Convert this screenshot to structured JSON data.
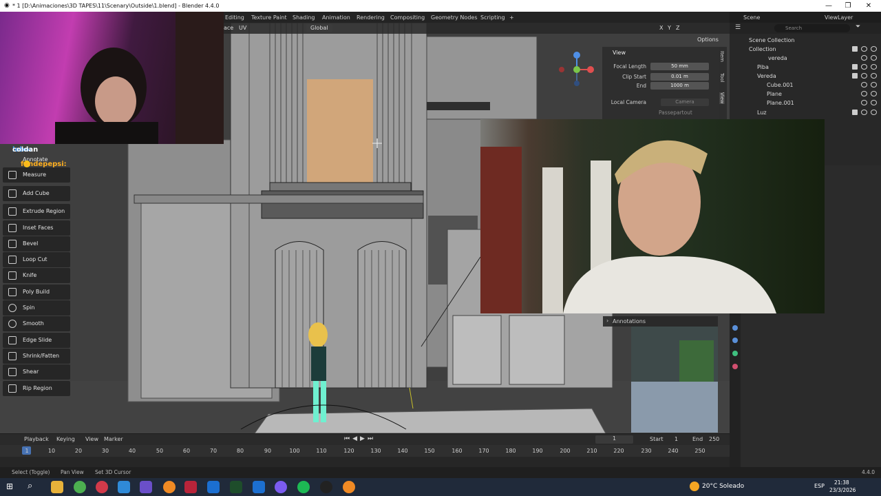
{
  "title_bar": {
    "title": "* 1 [D:\\Animaciones\\3D TAPES\\11\\Scenary\\Outside\\1.blend] - Blender 4.4.0",
    "min": "—",
    "max": "❐",
    "close": "✕"
  },
  "workspace_tabs": [
    "Editing",
    "Texture Paint",
    "Shading",
    "Animation",
    "Rendering",
    "Compositing",
    "Geometry Nodes",
    "Scripting",
    "+"
  ],
  "scene": {
    "label": "Scene",
    "view_layer": "ViewLayer"
  },
  "viewport_header": {
    "face_label": "ace",
    "uv": "UV",
    "orientation": "Global",
    "options": "Options",
    "axes": [
      "X",
      "Y",
      "Z"
    ]
  },
  "tools": [
    "Annotate",
    "Measure",
    "Add Cube",
    "Extrude Region",
    "Inset Faces",
    "Bevel",
    "Loop Cut",
    "Knife",
    "Poly Build",
    "Spin",
    "Smooth",
    "Edge Slide",
    "Shrink/Fatten",
    "Shear",
    "Rip Region"
  ],
  "chat": [
    {
      "user": "lobo:",
      "msg": "coldan",
      "color": "#4aa3ff"
    },
    {
      "user": "fandepepsi:",
      "msg": "",
      "color": "#ffb020"
    }
  ],
  "view_panel": {
    "header": "View",
    "focal_length_label": "Focal Length",
    "focal_length": "50 mm",
    "clip_start_label": "Clip Start",
    "clip_start": "0.01 m",
    "end_label": "End",
    "clip_end": "1000 m",
    "local_camera_label": "Local Camera",
    "camera": "Camera",
    "passepartout": "Passepartout",
    "tabs": [
      "Item",
      "Tool",
      "View"
    ]
  },
  "annotations_label": "Annotations",
  "outliner": {
    "search_placeholder": "Search",
    "root": "Scene Collection",
    "rows": [
      {
        "name": "Collection",
        "indent": 0
      },
      {
        "name": "vereda",
        "indent": 1
      },
      {
        "name": "Piba",
        "indent": 0
      },
      {
        "name": "Vereda",
        "indent": 0
      },
      {
        "name": "Cube.001",
        "indent": 1
      },
      {
        "name": "Plane",
        "indent": 1
      },
      {
        "name": "Plane.001",
        "indent": 1
      },
      {
        "name": "Luz",
        "indent": 0
      }
    ]
  },
  "timeline": {
    "menus": [
      "Playback",
      "Keying",
      "View",
      "Marker"
    ],
    "current_frame": "1",
    "start_label": "Start",
    "start": "1",
    "end_label": "End",
    "end": "250",
    "ticks": [
      "1",
      "10",
      "20",
      "30",
      "40",
      "50",
      "60",
      "70",
      "80",
      "90",
      "100",
      "110",
      "120",
      "130",
      "140",
      "150",
      "160",
      "170",
      "180",
      "190",
      "200",
      "210",
      "220",
      "230",
      "240",
      "250"
    ]
  },
  "status_bar": {
    "select": "Select (Toggle)",
    "pan": "Pan View",
    "cursor": "Set 3D Cursor",
    "version": "4.4.0"
  },
  "taskbar": {
    "weather": "20°C Soleado",
    "lang": "ESP",
    "time": "21:38",
    "date": "23/3/2026"
  }
}
